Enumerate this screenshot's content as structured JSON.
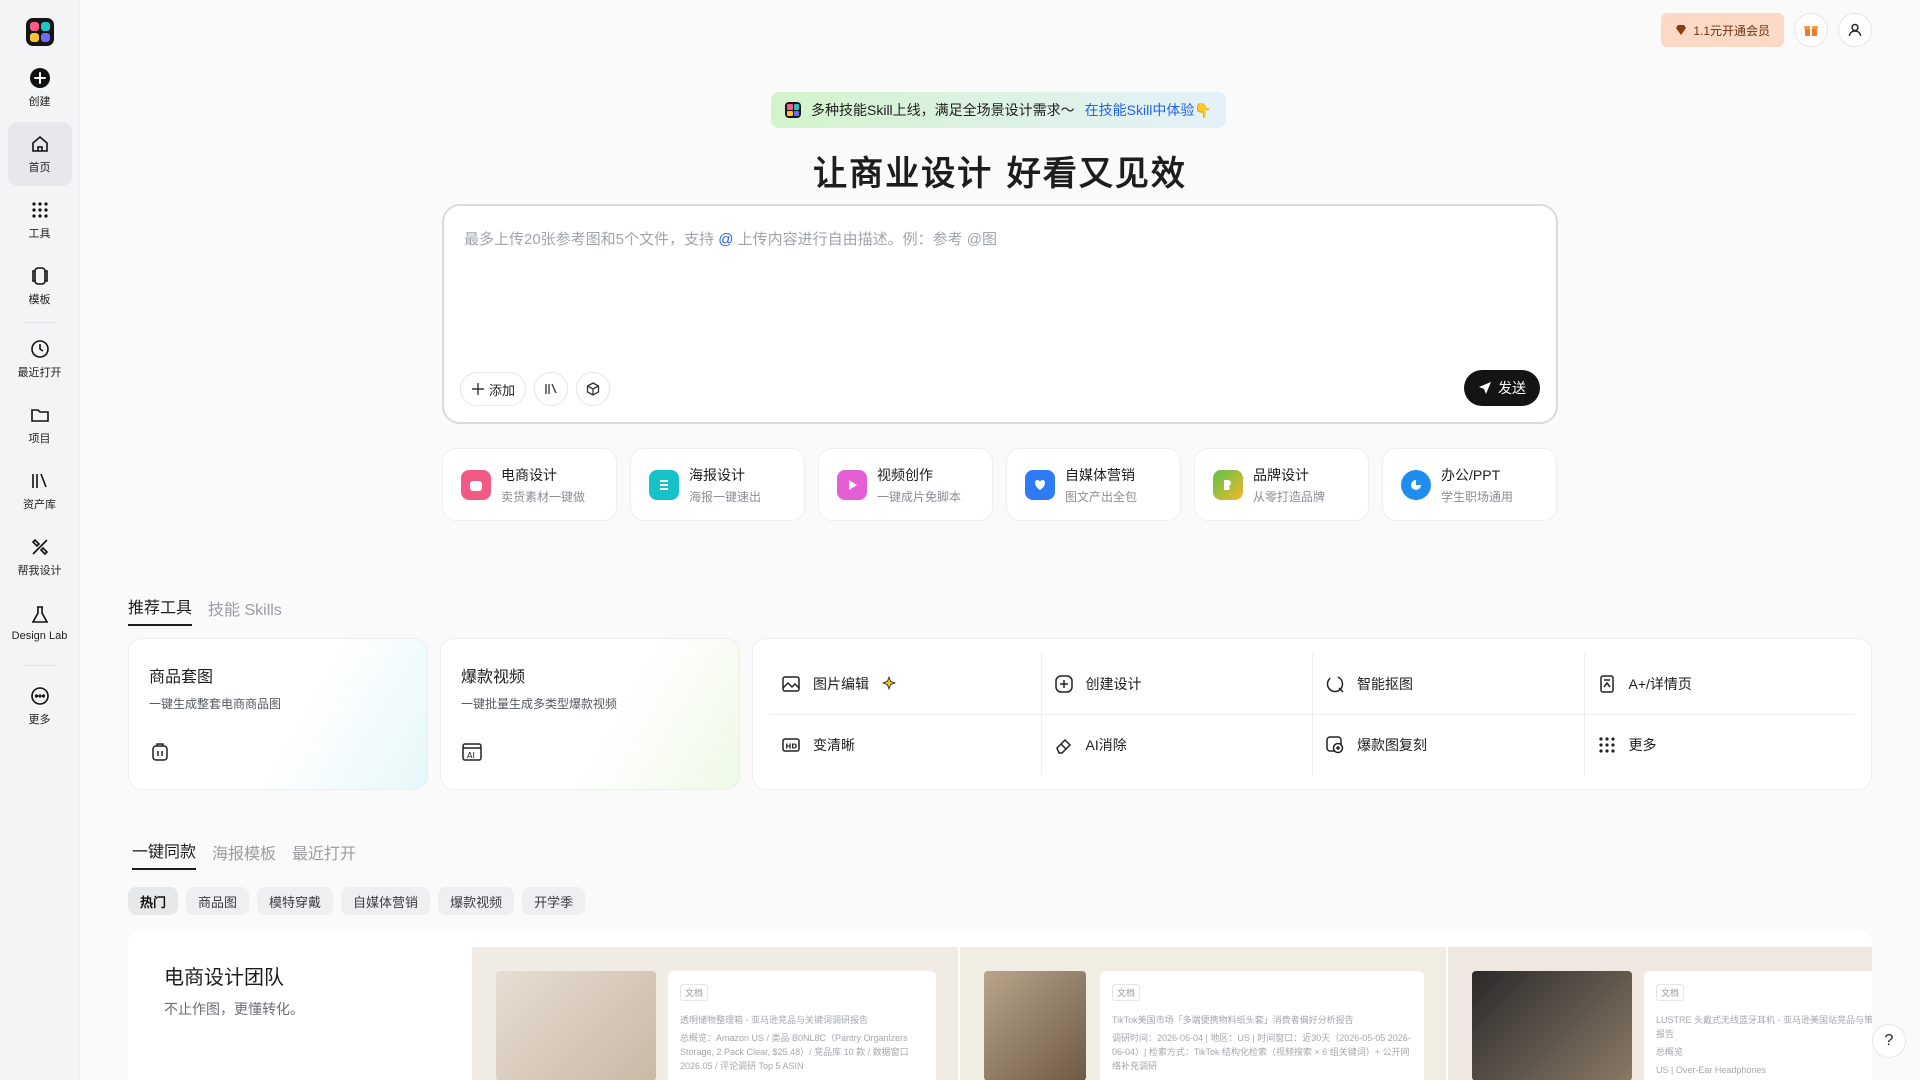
{
  "sidebar": {
    "items": [
      {
        "label": "创建",
        "icon": "plus-circle-icon"
      },
      {
        "label": "首页",
        "icon": "home-icon"
      },
      {
        "label": "工具",
        "icon": "grid-dots-icon"
      },
      {
        "label": "模板",
        "icon": "template-icon"
      },
      {
        "label": "最近打开",
        "icon": "clock-icon"
      },
      {
        "label": "项目",
        "icon": "folder-icon"
      },
      {
        "label": "资产库",
        "icon": "library-icon"
      },
      {
        "label": "帮我设计",
        "icon": "design-assist-icon"
      },
      {
        "label": "Design Lab",
        "icon": "lab-icon"
      },
      {
        "label": "更多",
        "icon": "more-icon"
      }
    ]
  },
  "topbar": {
    "vip_label": "1.1元开通会员",
    "gift_icon": "gift-icon",
    "user_icon": "user-icon"
  },
  "banner": {
    "text": "多种技能Skill上线，满足全场景设计需求～",
    "link": "在技能Skill中体验👇"
  },
  "headline": "让商业设计 好看又见效",
  "prompt": {
    "placeholder_before": "最多上传20张参考图和5个文件，支持 ",
    "placeholder_at": "@",
    "placeholder_after": " 上传内容进行自由描述。例：参考 @图",
    "add_label": "添加",
    "send_label": "发送"
  },
  "categories": [
    {
      "title": "电商设计",
      "sub": "卖货素材一键做",
      "color": "#f25a86"
    },
    {
      "title": "海报设计",
      "sub": "海报一键速出",
      "color": "#16c1c8"
    },
    {
      "title": "视频创作",
      "sub": "一键成片免脚本",
      "color": "#e45fd6"
    },
    {
      "title": "自媒体营销",
      "sub": "图文产出全包",
      "color": "#2f7bf6"
    },
    {
      "title": "品牌设计",
      "sub": "从零打造品牌",
      "color": "#5bc24a"
    },
    {
      "title": "办公/PPT",
      "sub": "学生职场通用",
      "color": "#1f8cf0"
    }
  ],
  "tool_tabs": [
    "推荐工具",
    "技能 Skills"
  ],
  "featured": [
    {
      "title": "商品套图",
      "sub": "一键生成整套电商商品图"
    },
    {
      "title": "爆款视频",
      "sub": "一键批量生成多类型爆款视频"
    }
  ],
  "grid_tools": [
    {
      "label": "图片编辑",
      "icon": "image-edit-icon"
    },
    {
      "label": "创建设计",
      "icon": "plus-square-icon"
    },
    {
      "label": "智能抠图",
      "icon": "cutout-icon"
    },
    {
      "label": "A+/详情页",
      "icon": "detail-page-icon"
    },
    {
      "label": "变清晰",
      "icon": "hd-icon"
    },
    {
      "label": "AI消除",
      "icon": "eraser-icon"
    },
    {
      "label": "爆款图复刻",
      "icon": "replicate-icon"
    },
    {
      "label": "更多",
      "icon": "grid-dots-icon"
    }
  ],
  "template_tabs": [
    "一键同款",
    "海报模板",
    "最近打开"
  ],
  "filters": [
    "热门",
    "商品图",
    "模特穿戴",
    "自媒体营销",
    "爆款视频",
    "开学季"
  ],
  "showcase": {
    "title": "电商设计团队",
    "sub": "不止作图，更懂转化。",
    "cards": [
      {
        "tag": "文档",
        "lines": [
          "透明储物整理箱 - 亚马逊竞品与关键词调研报告",
          "总概览：Amazon US / 类品 B0NL8C（Pantry Organizers Storage, 2 Pack Clear, $25.48）/ 竞品库 10 款 / 数据窗口 2026.05 / 评论调研 Top 5 ASIN"
        ]
      },
      {
        "tag": "文档",
        "lines": [
          "TikTok美国市场「多端便携物料纸头套」消费者偏好分析报告",
          "调研时间：2026-06-04 | 地区：US | 时间窗口：近30天（2026-05-05 2026-06-04）| 检索方式：TikTok 结构化检索（视频搜索 × 6 组关键词）+ 公开网络补充调研"
        ]
      },
      {
        "tag": "文档",
        "lines": [
          "LUSTRE 头戴式无线蓝牙耳机 - 亚马逊美国站竞品与策略分析报告",
          "总概览",
          "US | Over-Ear Headphones"
        ]
      }
    ]
  },
  "help_label": "?"
}
